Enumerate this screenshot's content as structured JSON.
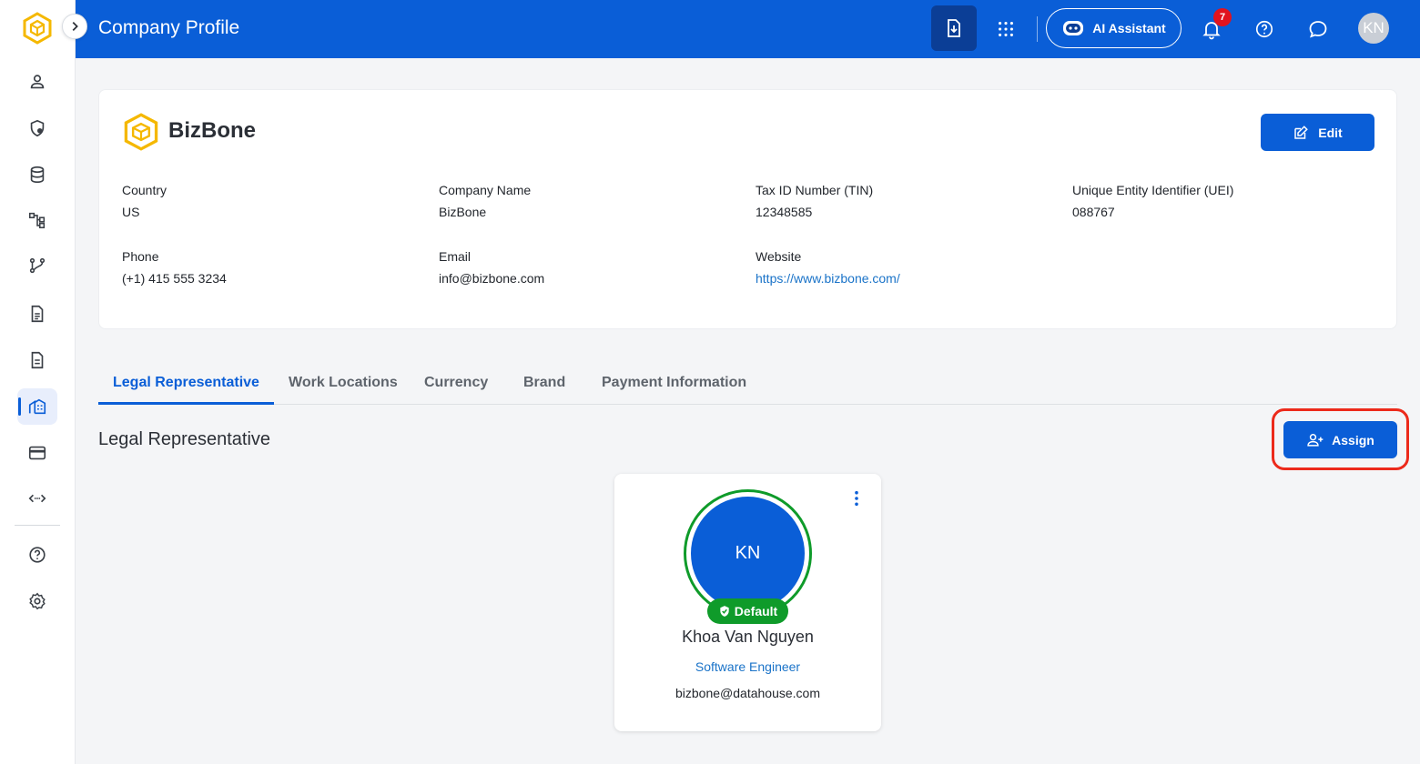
{
  "header": {
    "title": "Company Profile",
    "ai_assistant_label": "AI Assistant",
    "notification_count": "7",
    "user_initials": "KN"
  },
  "company": {
    "name": "BizBone",
    "edit_label": "Edit",
    "fields": {
      "country": {
        "label": "Country",
        "value": "US"
      },
      "company_name": {
        "label": "Company Name",
        "value": "BizBone"
      },
      "tin": {
        "label": "Tax ID Number (TIN)",
        "value": "12348585"
      },
      "uei": {
        "label": "Unique Entity Identifier (UEI)",
        "value": "088767"
      },
      "phone": {
        "label": "Phone",
        "value": "(+1) 415 555 3234"
      },
      "email": {
        "label": "Email",
        "value": "info@bizbone.com"
      },
      "website": {
        "label": "Website",
        "value": "https://www.bizbone.com/"
      }
    }
  },
  "tabs": [
    {
      "label": "Legal Representative",
      "active": true
    },
    {
      "label": "Work Locations",
      "active": false
    },
    {
      "label": "Currency",
      "active": false
    },
    {
      "label": "Brand",
      "active": false
    },
    {
      "label": "Payment Information",
      "active": false
    }
  ],
  "section": {
    "title": "Legal Representative",
    "assign_label": "Assign"
  },
  "representative": {
    "initials": "KN",
    "badge": "Default",
    "name": "Khoa Van Nguyen",
    "role": "Software Engineer",
    "email": "bizbone@datahouse.com"
  },
  "sidebar": {
    "items": [
      {
        "icon": "user-icon"
      },
      {
        "icon": "shield-icon"
      },
      {
        "icon": "database-icon"
      },
      {
        "icon": "org-chart-icon"
      },
      {
        "icon": "workflow-icon"
      },
      {
        "icon": "document-icon"
      },
      {
        "icon": "file-icon"
      },
      {
        "icon": "company-icon",
        "active": true
      },
      {
        "icon": "card-icon"
      },
      {
        "icon": "api-icon"
      },
      {
        "icon": "help-icon"
      },
      {
        "icon": "settings-icon"
      }
    ]
  },
  "colors": {
    "primary": "#0a5ed7",
    "success": "#0f9b2a",
    "highlight": "#ec2a1b",
    "brand_logo": "#f5b800"
  }
}
